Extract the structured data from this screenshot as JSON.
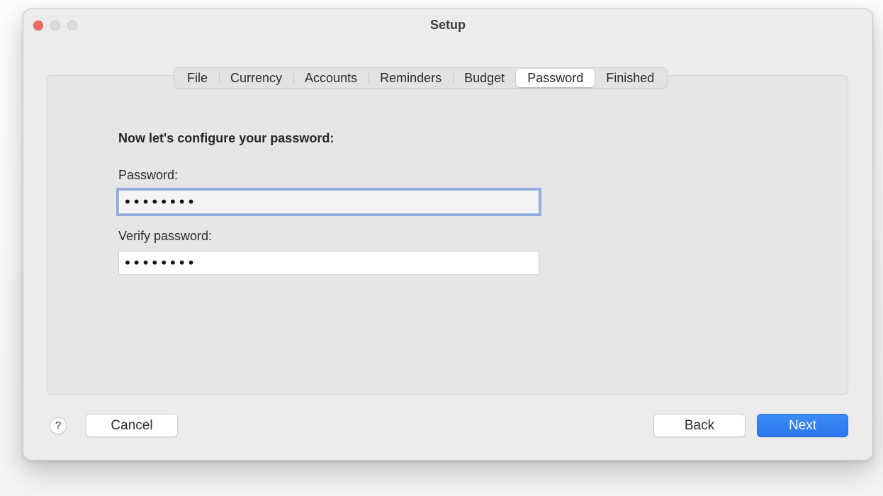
{
  "window": {
    "title": "Setup"
  },
  "tabs": [
    {
      "label": "File"
    },
    {
      "label": "Currency"
    },
    {
      "label": "Accounts"
    },
    {
      "label": "Reminders"
    },
    {
      "label": "Budget"
    },
    {
      "label": "Password",
      "active": true
    },
    {
      "label": "Finished"
    }
  ],
  "form": {
    "heading": "Now let's configure your password:",
    "password_label": "Password:",
    "password_value": "••••••••",
    "verify_label": "Verify password:",
    "verify_value": "••••••••"
  },
  "footer": {
    "help_label": "?",
    "cancel_label": "Cancel",
    "back_label": "Back",
    "next_label": "Next"
  },
  "colors": {
    "close_button": "#ed6a5e",
    "primary_button": "#2b74ee",
    "focus_ring": "#7698de"
  }
}
